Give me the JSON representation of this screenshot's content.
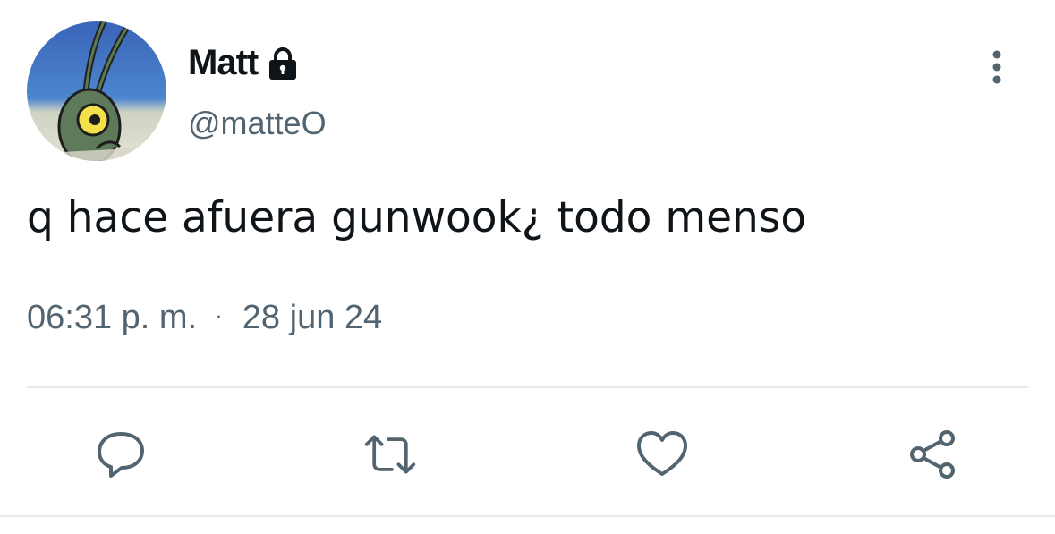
{
  "author": {
    "display_name": "Matt",
    "handle": "@matteO",
    "protected_icon": "lock-icon",
    "avatar_icon": "plankton-avatar"
  },
  "tweet": {
    "text": "q hace afuera gunwook¿ todo menso",
    "time": "06:31 p. m.",
    "separator": "·",
    "date": "28 jun 24"
  },
  "actions": [
    {
      "name": "reply",
      "icon": "reply-icon"
    },
    {
      "name": "retweet",
      "icon": "retweet-icon"
    },
    {
      "name": "like",
      "icon": "heart-icon"
    },
    {
      "name": "share",
      "icon": "share-icon"
    }
  ],
  "menu": {
    "icon": "more-vertical-icon"
  },
  "colors": {
    "text_primary": "#0f1419",
    "text_secondary": "#536471",
    "divider": "#e7e9ea",
    "icon": "#536471"
  }
}
